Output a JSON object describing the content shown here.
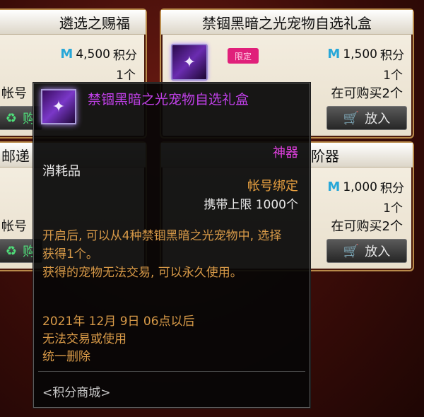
{
  "left_card_top": {
    "title": "遴选之赐福",
    "price": "4,500",
    "price_unit": "积分",
    "quantity": "1个",
    "limit_partial": "帐号",
    "buy_label": "购"
  },
  "right_card_top": {
    "title": "禁锢黑暗之光宠物自选礼盒",
    "badge": "限定",
    "price": "1,500",
    "price_unit": "积分",
    "quantity": "1个",
    "limit_text": "在可购买2个",
    "put_label": "放入"
  },
  "left_card_bottom": {
    "title_partial": "邮递",
    "limit_partial": "帐号",
    "buy_label": "购"
  },
  "right_card_bottom": {
    "title_partial": "阶器",
    "price": "1,000",
    "price_unit": "积分",
    "quantity": "1个",
    "limit_text": "在可购买2个",
    "put_label": "放入"
  },
  "tooltip": {
    "title": "禁锢黑暗之光宠物自选礼盒",
    "grade": "神器",
    "item_type": "消耗品",
    "bind": "帐号绑定",
    "carry_limit": "携带上限   1000个",
    "desc_1": "开启后, 可以从4种禁锢黑暗之光宠物中, 选择获得1个。",
    "desc_2": "获得的宠物无法交易, 可以永久使用。",
    "expire_1": "2021年 12月 9日 06点以后",
    "expire_2": "无法交易或使用",
    "expire_3": "统一删除",
    "source": "<积分商城>"
  }
}
